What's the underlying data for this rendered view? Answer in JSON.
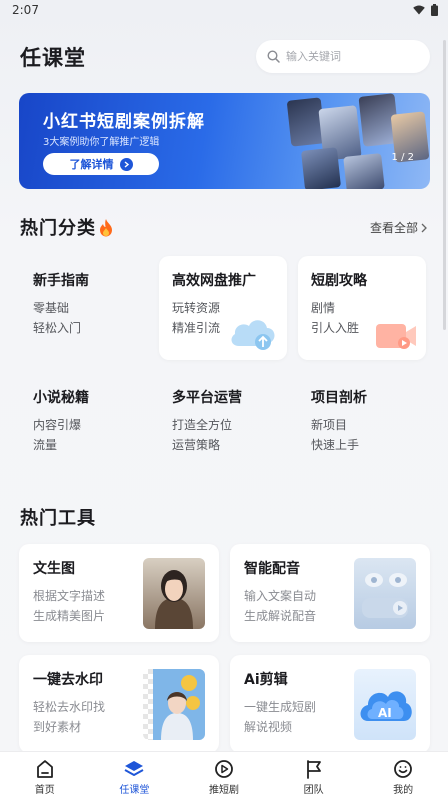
{
  "status_bar": {
    "time": "2:07"
  },
  "header": {
    "title": "任课堂",
    "search_placeholder": "输入关键词"
  },
  "banner": {
    "title": "小红书短剧案例拆解",
    "subtitle": "3大案例助你了解推广逻辑",
    "button_label": "了解详情",
    "page_indicator": "1 / 2"
  },
  "hot_categories": {
    "title": "热门分类",
    "view_all": "查看全部",
    "items": [
      {
        "title": "新手指南",
        "desc_line1": "零基础",
        "desc_line2": "轻松入门"
      },
      {
        "title": "高效网盘推广",
        "desc_line1": "玩转资源",
        "desc_line2": "精准引流",
        "icon": "cloud-upload-icon"
      },
      {
        "title": "短剧攻略",
        "desc_line1": "剧情",
        "desc_line2": "引人入胜",
        "icon": "video-camera-icon"
      },
      {
        "title": "小说秘籍",
        "desc_line1": "内容引爆",
        "desc_line2": "流量"
      },
      {
        "title": "多平台运营",
        "desc_line1": "打造全方位",
        "desc_line2": "运营策略"
      },
      {
        "title": "项目剖析",
        "desc_line1": "新项目",
        "desc_line2": "快速上手"
      }
    ]
  },
  "hot_tools": {
    "title": "热门工具",
    "items": [
      {
        "title": "文生图",
        "desc_line1": "根据文字描述",
        "desc_line2": "生成精美图片"
      },
      {
        "title": "智能配音",
        "desc_line1": "输入文案自动",
        "desc_line2": "生成解说配音"
      },
      {
        "title": "一键去水印",
        "desc_line1": "轻松去水印找",
        "desc_line2": "到好素材"
      },
      {
        "title": "Ai剪辑",
        "desc_line1": "一键生成短剧",
        "desc_line2": "解说视频"
      }
    ]
  },
  "bottom_nav": [
    {
      "label": "首页",
      "icon": "home-icon"
    },
    {
      "label": "任课堂",
      "icon": "layers-icon",
      "active": true
    },
    {
      "label": "推短剧",
      "icon": "play-circle-icon"
    },
    {
      "label": "团队",
      "icon": "flag-icon"
    },
    {
      "label": "我的",
      "icon": "smile-icon"
    }
  ],
  "colors": {
    "accent": "#1f56d8",
    "banner_start": "#1846c8",
    "banner_end": "#8fb8f5"
  }
}
